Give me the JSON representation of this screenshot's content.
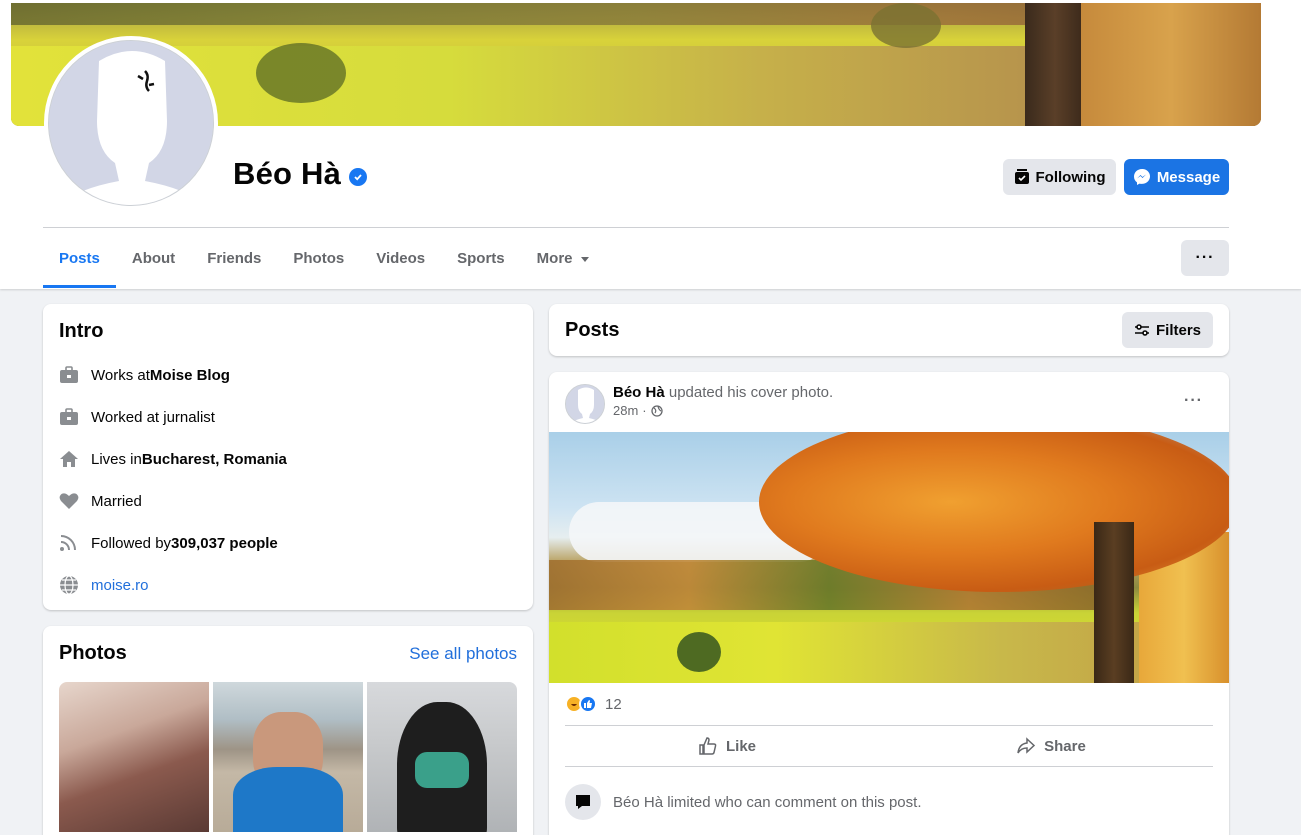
{
  "profile": {
    "name": "Béo Hà",
    "verified": true
  },
  "header_buttons": {
    "following_label": "Following",
    "message_label": "Message"
  },
  "tabs": [
    {
      "label": "Posts",
      "active": true
    },
    {
      "label": "About"
    },
    {
      "label": "Friends"
    },
    {
      "label": "Photos"
    },
    {
      "label": "Videos"
    },
    {
      "label": "Sports"
    },
    {
      "label": "More"
    }
  ],
  "more_button_label": "···",
  "intro": {
    "title": "Intro",
    "items": [
      {
        "icon": "briefcase-icon",
        "prefix": "Works at ",
        "bold": "Moise Blog"
      },
      {
        "icon": "briefcase-icon",
        "prefix": "Worked at jurnalist",
        "bold": ""
      },
      {
        "icon": "home-icon",
        "prefix": "Lives in ",
        "bold": "Bucharest, Romania"
      },
      {
        "icon": "heart-icon",
        "prefix": "Married",
        "bold": ""
      },
      {
        "icon": "rss-icon",
        "prefix": "Followed by ",
        "bold": "309,037 people"
      },
      {
        "icon": "globe-icon",
        "link": "moise.ro"
      }
    ]
  },
  "photos": {
    "title": "Photos",
    "see_all": "See all photos"
  },
  "posts_header": {
    "title": "Posts",
    "filters_label": "Filters"
  },
  "post": {
    "author": "Béo Hà",
    "action": " updated his cover photo.",
    "time": "28m",
    "separator": "·",
    "reaction_count": "12",
    "like_label": "Like",
    "share_label": "Share",
    "comment_note": "Béo Hà limited who can comment on this post.",
    "menu": "···"
  },
  "colors": {
    "accent": "#1877f2",
    "page_bg": "#f0f2f5",
    "secondary_text": "#65676b"
  }
}
